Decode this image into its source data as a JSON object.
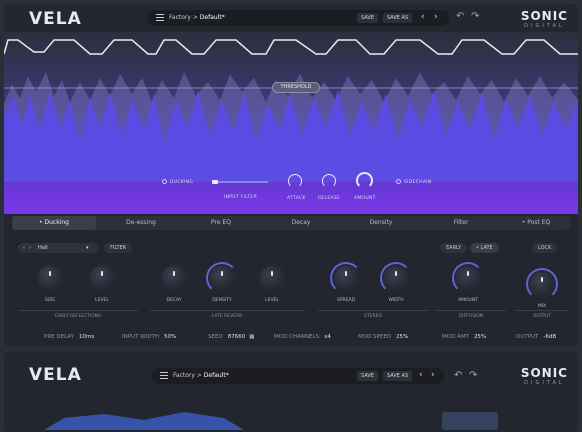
{
  "header": {
    "logo": "VELA",
    "preset_path": "Factory",
    "preset_sep": ">",
    "preset_name": "Default*",
    "save_label": "SAVE",
    "save_as_label": "SAVE AS",
    "prev_icon": "chevron-left-icon",
    "next_icon": "chevron-right-icon",
    "undo_icon": "undo-icon",
    "redo_icon": "redo-icon",
    "brand_big": "SONIC",
    "brand_small": "DIGITAL"
  },
  "display": {
    "threshold_label": "THRESHOLD",
    "ducking_label": "DUCKING",
    "input_filter_label": "INPUT FILTER",
    "attack_label": "ATTACK",
    "release_label": "RELEASE",
    "amount_label": "AMOUNT",
    "sidechain_label": "SIDECHAIN"
  },
  "tabs": [
    {
      "label": "Ducking",
      "active": true
    },
    {
      "label": "De-essing",
      "active": false
    },
    {
      "label": "Pre EQ",
      "active": false
    },
    {
      "label": "Decay",
      "active": false
    },
    {
      "label": "Density",
      "active": false
    },
    {
      "label": "Filter",
      "active": false
    },
    {
      "label": "Post EQ",
      "active": false
    }
  ],
  "panel": {
    "algorithm": "Hall",
    "filter_label": "FILTER",
    "early_label": "EARLY",
    "late_label": "LATE",
    "lock_label": "LOCK",
    "knobs": [
      {
        "label": "SIZE"
      },
      {
        "label": "LEVEL"
      },
      {
        "label": "DECAY"
      },
      {
        "label": "DENSITY"
      },
      {
        "label": "LEVEL"
      },
      {
        "label": "SPREAD"
      },
      {
        "label": "WIDTH"
      },
      {
        "label": "AMOUNT"
      },
      {
        "label": "MIX"
      }
    ],
    "groups": [
      "EARLY REFLECTIONS",
      "LATE REVERB",
      "STEREO",
      "DIFFUSION",
      "OUTPUT"
    ]
  },
  "footer": {
    "pre_delay_label": "PRE DELAY",
    "pre_delay_value": "10ms",
    "input_width_label": "INPUT WIDTH",
    "input_width_value": "50%",
    "seed_label": "SEED",
    "seed_value": "87660",
    "mod_channels_label": "MOD CHANNELS",
    "mod_channels_value": "x4",
    "mod_speed_label": "MOD SPEED",
    "mod_speed_value": "25%",
    "mod_amt_label": "MOD AMT",
    "mod_amt_value": "25%",
    "output_label": "OUTPUT",
    "output_value": "-6dB"
  },
  "second_window": {
    "logo": "VELA",
    "preset_path": "Factory",
    "preset_sep": ">",
    "preset_name": "Default*",
    "save_label": "SAVE",
    "save_as_label": "SAVE AS",
    "brand_big": "SONIC",
    "brand_small": "DIGITAL"
  },
  "colors": {
    "accent": "#5b63d8",
    "waveform_top": "#3a3567",
    "waveform_bottom": "#7a38e8"
  }
}
